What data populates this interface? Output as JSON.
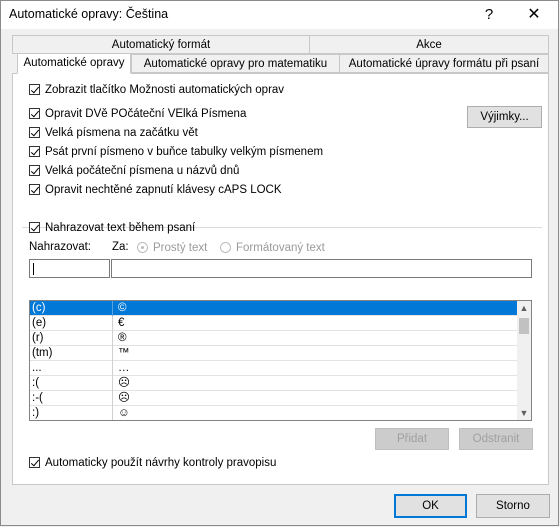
{
  "window": {
    "title": "Automatické opravy: Čeština",
    "help": "?",
    "close": "✕"
  },
  "tabs_row1": [
    "Automatický formát",
    "Akce"
  ],
  "tabs_row2": [
    "Automatické opravy",
    "Automatické opravy pro matematiku",
    "Automatické úpravy formátu při psaní"
  ],
  "options": {
    "show_button": "Zobrazit tlačítko Možnosti automatických oprav",
    "two_initial": "Opravit DVě POčáteční VElká Písmena",
    "sentence_caps": "Velká písmena na začátku vět",
    "table_cell_caps": "Psát první písmeno v buňce tabulky velkým písmenem",
    "day_names": "Velká počáteční písmena u názvů dnů",
    "caps_lock": "Opravit nechtěné zapnutí klávesy cAPS LOCK",
    "exceptions_button": "Výjimky..."
  },
  "replace": {
    "checkbox_label": "Nahrazovat text během psaní",
    "col_replace": "Nahrazovat:",
    "col_with": "Za:",
    "radio_plain": "Prostý text",
    "radio_formatted": "Formátovaný text",
    "replace_value": "",
    "with_value": ""
  },
  "entries": [
    {
      "from": "(c)",
      "to": "©"
    },
    {
      "from": "(e)",
      "to": "€"
    },
    {
      "from": "(r)",
      "to": "®"
    },
    {
      "from": "(tm)",
      "to": "™"
    },
    {
      "from": "...",
      "to": "…"
    },
    {
      "from": ":(",
      "to": "☹"
    },
    {
      "from": ":-(",
      "to": "☹"
    },
    {
      "from": ":)",
      "to": "☺"
    }
  ],
  "list_buttons": {
    "add": "Přidat",
    "delete": "Odstranit"
  },
  "spellcheck": "Automaticky použít návrhy kontroly pravopisu",
  "footer": {
    "ok": "OK",
    "cancel": "Storno"
  },
  "icons": {
    "scroll_up": "▲",
    "scroll_down": "▼"
  }
}
